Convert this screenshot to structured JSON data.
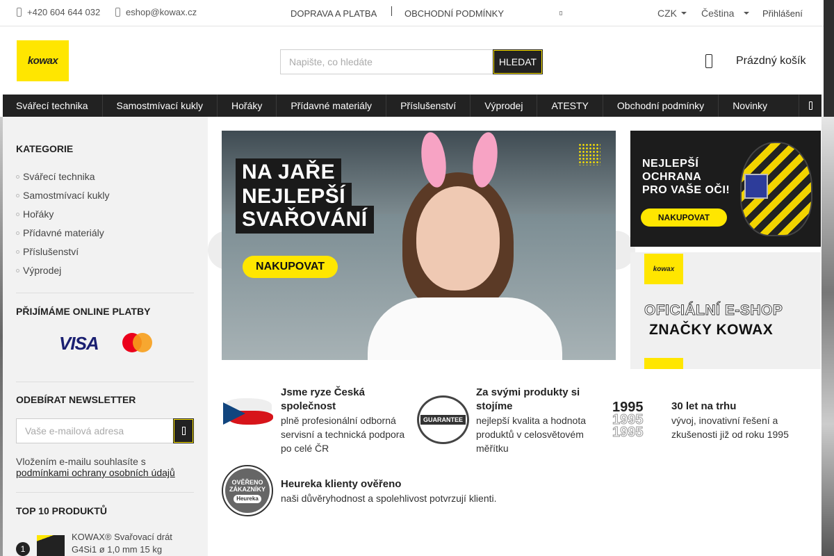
{
  "topbar": {
    "phone": "+420 604 644 032",
    "email": "eshop@kowax.cz",
    "links": [
      "DOPRAVA A PLATBA",
      "OBCHODNÍ PODMÍNKY"
    ],
    "currency": "CZK",
    "language": "Čeština",
    "login": "Přihlášení"
  },
  "header": {
    "logo_text": "kowax",
    "search_placeholder": "Napište, co hledáte",
    "search_button": "HLEDAT",
    "cart_label": "Prázdný košík"
  },
  "nav": {
    "items": [
      "Svářecí technika",
      "Samostmívací kukly",
      "Hořáky",
      "Přídavné materiály",
      "Příslušenství",
      "Výprodej",
      "ATESTY",
      "Obchodní podmínky",
      "Novinky"
    ]
  },
  "sidebar": {
    "categories_title": "KATEGORIE",
    "categories": [
      "Svářecí technika",
      "Samostmívací kukly",
      "Hořáky",
      "Přídavné materiály",
      "Příslušenství",
      "Výprodej"
    ],
    "payments_title": "PŘIJÍMÁME ONLINE PLATBY",
    "visa": "VISA",
    "newsletter_title": "ODEBÍRAT NEWSLETTER",
    "newsletter_placeholder": "Vaše e-mailová adresa",
    "consent_text": "Vložením e-mailu souhlasíte s",
    "consent_link": "podmínkami ochrany osobních údajů",
    "top_title": "TOP 10 PRODUKTŮ",
    "top_items": [
      {
        "rank": "1",
        "name": "KOWAX® Svařovací drát G4Si1 ø 1,0 mm 15 kg"
      }
    ]
  },
  "hero": {
    "line1": "NA JAŘE",
    "line2": "NEJLEPŠÍ",
    "line3": "SVAŘOVÁNÍ",
    "button": "NAKUPOVAT"
  },
  "side_banner": {
    "line1": "NEJLEPŠÍ",
    "line2": "OCHRANA",
    "line3": "PRO VAŠE OČI!",
    "button": "NAKUPOVAT"
  },
  "official_banner": {
    "logo": "kowax",
    "line1": "OFICIÁLNÍ E-SHOP",
    "line2": "ZNAČKY KOWAX"
  },
  "features": [
    {
      "title": "Jsme ryze Česká společnost",
      "text": "plně profesionální odborná servisní a technická podpora po celé ČR"
    },
    {
      "title": "Za svými produkty si stojíme",
      "text": "nejlepší kvalita a hodnota produktů v celosvětovém měřítku",
      "badge": "GUARANTEE"
    },
    {
      "title": "30 let na trhu",
      "text": "vývoj, inovativní řešení a zkušenosti již od roku 1995",
      "year": "1995"
    },
    {
      "title": "Heureka klienty ověřeno",
      "text": "naši důvěryhodnost a spolehlivost potvrzují klienti.",
      "badge1": "OVĚŘENO",
      "badge2": "ZÁKAZNÍKY",
      "badge3": "Heureka"
    }
  ],
  "colors": {
    "accent": "#ffe600",
    "dark": "#222222"
  }
}
